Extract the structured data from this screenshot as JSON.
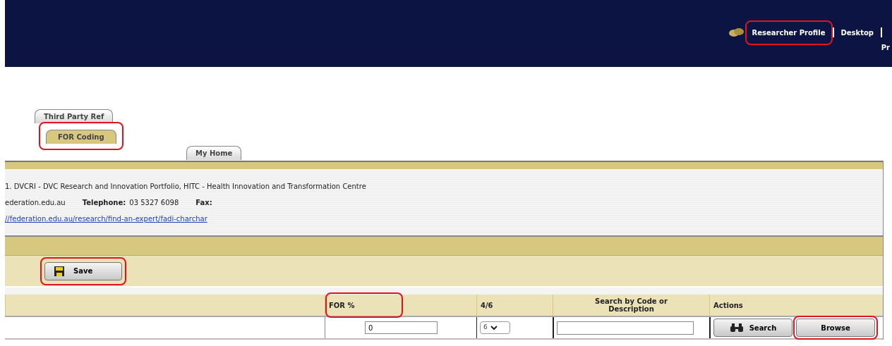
{
  "header": {
    "links": [
      {
        "label": "Researcher Profile",
        "highlighted": true
      },
      {
        "label": "Desktop",
        "highlighted": false
      }
    ],
    "cut_text": "Pr"
  },
  "tabs": [
    {
      "label": "Third Party Ref",
      "selected": false,
      "highlighted": false
    },
    {
      "label": "FOR Coding",
      "selected": true,
      "highlighted": true
    },
    {
      "label": "My Home",
      "selected": false,
      "highlighted": false
    }
  ],
  "info": {
    "lines": [
      "1. DVCRI - DVC Research and Innovation Portfolio, HITC - Health Innovation and Transformation Centre"
    ],
    "email": "ederation.edu.au",
    "telephone_label": "Telephone:",
    "telephone": "03 5327 6098",
    "fax_label": "Fax:",
    "link": "//federation.edu.au/research/find-an-expert/fadi-charchar"
  },
  "toolbar": {
    "save": {
      "label": "Save",
      "highlighted": true
    }
  },
  "table": {
    "columns": [
      {
        "highlighted": false
      },
      {
        "label": "FOR %",
        "highlighted": true
      },
      {
        "label": "4/6",
        "highlighted": false
      },
      {
        "label": "Search by Code or Description",
        "highlighted": false
      },
      {
        "label": "Actions",
        "highlighted": false
      }
    ],
    "rows": [
      {
        "percent": "0",
        "digits": "6",
        "search_button": {
          "label": "Search",
          "highlighted": false
        },
        "browse_button": {
          "label": "Browse",
          "highlighted": true
        }
      }
    ]
  }
}
